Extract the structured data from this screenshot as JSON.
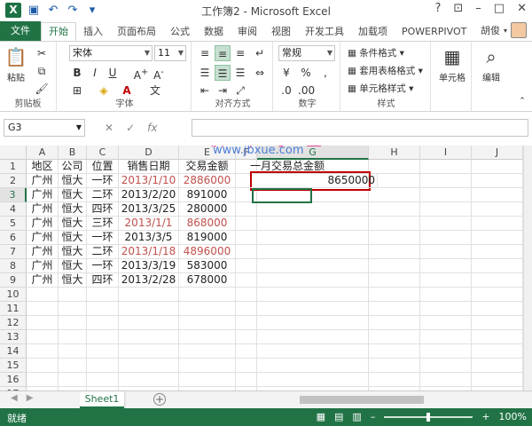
{
  "window": {
    "title": "工作簿2 - Microsoft Excel",
    "help": "?",
    "user": "胡俊"
  },
  "ribbon_tabs": [
    "文件",
    "开始",
    "插入",
    "页面布局",
    "公式",
    "数据",
    "审阅",
    "视图",
    "开发工具",
    "加载项",
    "POWERPIVOT"
  ],
  "ribbon": {
    "clipboard": {
      "paste": "粘贴",
      "group": "剪贴板"
    },
    "font": {
      "name": "宋体",
      "size": "11",
      "group": "字体"
    },
    "alignment": {
      "group": "对齐方式"
    },
    "number": {
      "format": "常规",
      "group": "数字"
    },
    "styles": {
      "conditional": "条件格式",
      "table": "套用表格格式",
      "cell": "单元格样式",
      "group": "样式"
    },
    "cells": {
      "label": "单元格"
    },
    "editing": {
      "label": "编辑"
    }
  },
  "formula_bar": {
    "name_box": "G3",
    "fx": "fx",
    "formula": ""
  },
  "columns": [
    "A",
    "B",
    "C",
    "D",
    "E",
    "F",
    "G",
    "H",
    "I",
    "J"
  ],
  "rows": [
    "1",
    "2",
    "3",
    "4",
    "5",
    "6",
    "7",
    "8",
    "9",
    "10",
    "11",
    "12",
    "13",
    "14",
    "15",
    "16",
    "17"
  ],
  "headers": [
    "地区",
    "公司",
    "位置",
    "销售日期",
    "交易金额"
  ],
  "table": [
    {
      "region": "广州",
      "company": "恒大",
      "position": "一环",
      "date": "2013/1/10",
      "amount": "2886000",
      "highlight": true
    },
    {
      "region": "广州",
      "company": "恒大",
      "position": "二环",
      "date": "2013/2/20",
      "amount": "891000",
      "highlight": false
    },
    {
      "region": "广州",
      "company": "恒大",
      "position": "四环",
      "date": "2013/3/25",
      "amount": "280000",
      "highlight": false
    },
    {
      "region": "广州",
      "company": "恒大",
      "position": "三环",
      "date": "2013/1/1",
      "amount": "868000",
      "highlight": true
    },
    {
      "region": "广州",
      "company": "恒大",
      "position": "一环",
      "date": "2013/3/5",
      "amount": "819000",
      "highlight": false
    },
    {
      "region": "广州",
      "company": "恒大",
      "position": "二环",
      "date": "2013/1/18",
      "amount": "4896000",
      "highlight": true
    },
    {
      "region": "广州",
      "company": "恒大",
      "position": "一环",
      "date": "2013/3/19",
      "amount": "583000",
      "highlight": false
    },
    {
      "region": "广州",
      "company": "恒大",
      "position": "四环",
      "date": "2013/2/28",
      "amount": "678000",
      "highlight": false
    }
  ],
  "summary": {
    "label": "一月交易总金额",
    "value": "8650000"
  },
  "watermark": {
    "text": "脚 本 学 堂",
    "url": "www.jbxue.com"
  },
  "colors": {
    "excel_green": "#217346",
    "highlight_red": "#c0504d",
    "box_red": "#c00000"
  },
  "sheets": {
    "active": "Sheet1",
    "add": "+"
  },
  "status": {
    "ready": "就绪",
    "zoom": "100%"
  }
}
